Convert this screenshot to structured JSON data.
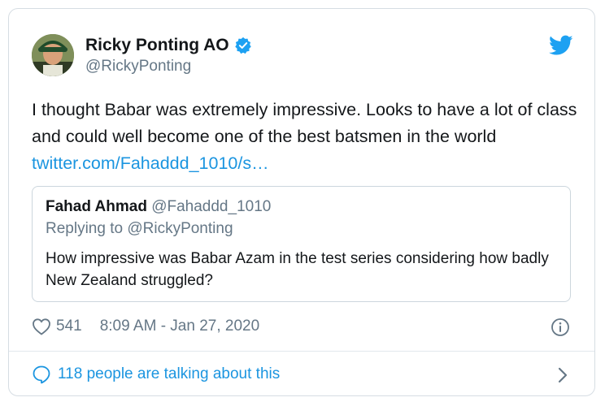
{
  "author": {
    "name": "Ricky Ponting AO",
    "handle": "@RickyPonting"
  },
  "tweet": {
    "text": "I thought Babar was extremely impressive. Looks to have a lot of class and could well become one of the best batsmen in the world ",
    "link": "twitter.com/Fahaddd_1010/s…"
  },
  "quoted": {
    "name": "Fahad Ahmad",
    "handle": "@Fahaddd_1010",
    "reply_to": "Replying to @RickyPonting",
    "text": "How impressive was Babar Azam in the test series considering how badly New Zealand struggled?"
  },
  "meta": {
    "likes": "541",
    "timestamp": "8:09 AM - Jan 27, 2020"
  },
  "footer": {
    "talking": "118 people are talking about this"
  },
  "icons": {
    "verified": "verified-badge-icon",
    "brand": "twitter-bird-icon",
    "like": "heart-icon",
    "info": "info-icon",
    "conversation": "speech-bubble-icon",
    "chevron": "chevron-right-icon"
  },
  "colors": {
    "link": "#1b95e0",
    "secondary_text": "#657786",
    "primary_text": "#14171a",
    "border": "#ccd6dd"
  }
}
